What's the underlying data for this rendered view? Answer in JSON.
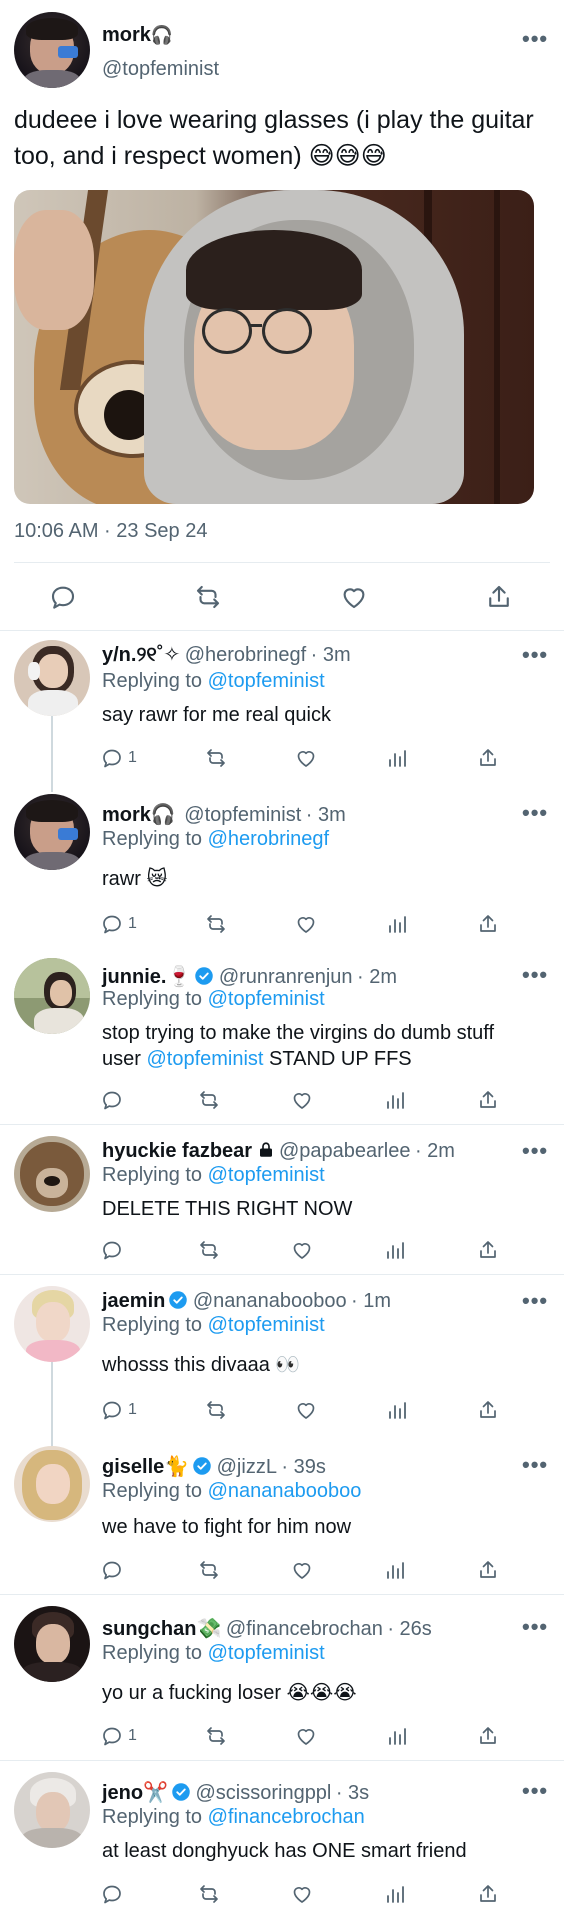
{
  "main_tweet": {
    "name": "mork",
    "name_glyph": "🎧",
    "handle": "@topfeminist",
    "text": "dudeee i love wearing glasses (i play the guitar too, and i respect women) 😅😅😅",
    "timestamp": "10:06 AM · 23 Sep 24",
    "more": "•••"
  },
  "replies": [
    {
      "name": "y/n.୨୧˚✧",
      "handle": "@herobrinegf",
      "time": "· 3m",
      "replying_prefix": "Replying to",
      "replying_to": "@topfeminist",
      "text": "say rawr for me real quick",
      "reply_count": "1"
    },
    {
      "name": "mork🎧",
      "handle": "@topfeminist",
      "time": "· 3m",
      "replying_prefix": "Replying to",
      "replying_to": "@herobrinegf",
      "text": "rawr 😿",
      "reply_count": "1"
    },
    {
      "name": "junnie.🍷",
      "handle": "@runranrenjun",
      "time": "· 2m",
      "replying_prefix": "Replying to",
      "replying_to": "@topfeminist",
      "text_a": "stop trying to make the virgins do dumb stuff",
      "text_b_prefix": "user ",
      "text_b_link": "@topfeminist",
      "text_b_suffix": " STAND UP FFS",
      "reply_count": ""
    },
    {
      "name": "hyuckie fazbear",
      "handle": "@papabearlee",
      "time": "· 2m",
      "replying_prefix": "Replying to",
      "replying_to": "@topfeminist",
      "text": "DELETE THIS RIGHT NOW",
      "reply_count": ""
    },
    {
      "name": "jaemin",
      "handle": "@nananabooboo",
      "time": "· 1m",
      "replying_prefix": "Replying to",
      "replying_to": "@topfeminist",
      "text": "whosss this divaaa 👀",
      "reply_count": "1"
    },
    {
      "name": "giselle🐈",
      "handle": "@jizzL",
      "time": "· 39s",
      "replying_prefix": "Replying to",
      "replying_to": "@nananabooboo",
      "text": "we have to fight for him now",
      "reply_count": ""
    },
    {
      "name": "sungchan💸",
      "handle": "@financebrochan",
      "time": "· 26s",
      "replying_prefix": "Replying to",
      "replying_to": "@topfeminist",
      "text": "yo ur a fucking loser 😭😭😭",
      "reply_count": "1"
    },
    {
      "name": "jeno✂️",
      "handle": "@scissoringppl",
      "time": "· 3s",
      "replying_prefix": "Replying to",
      "replying_to": "@financebrochan",
      "text": "at least donghyuck has ONE smart friend",
      "reply_count": ""
    }
  ],
  "more_icon": "•••",
  "colors": {
    "link": "#1d9bf0",
    "verified": "#1d9bf0",
    "muted": "#536471"
  }
}
